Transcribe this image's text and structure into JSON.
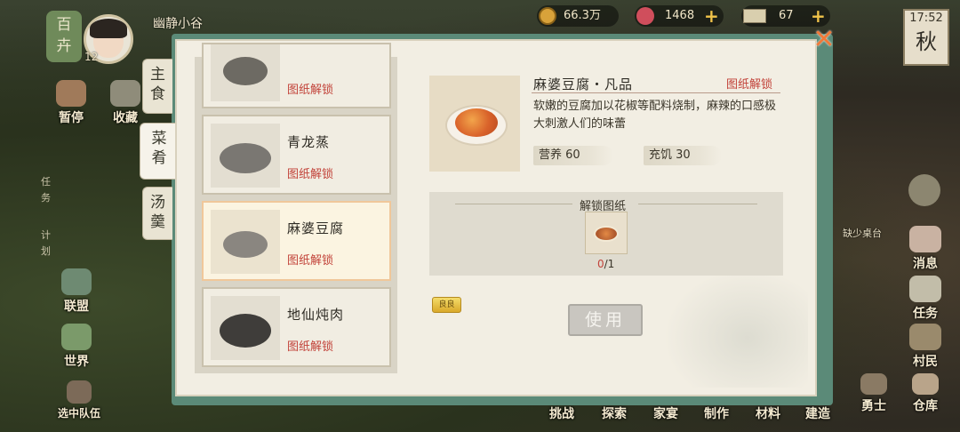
{
  "hud": {
    "region_badge": "百卉",
    "level": "12",
    "player_name": "幽静小谷",
    "copper": "66.3万",
    "gem": "1468",
    "ticket": "67",
    "time": "17:52",
    "season": "秋"
  },
  "left_menu": {
    "item1": "暂停",
    "item2": "收藏",
    "task": "任务",
    "plan": "计划",
    "alliance": "联盟",
    "world": "世界",
    "team": "选中队伍"
  },
  "right_menu": {
    "hint": "缺少桌台",
    "message": "消息",
    "task": "任务",
    "villager": "村民",
    "warrior": "勇士",
    "warehouse": "仓库"
  },
  "bottom_bar": [
    "挑战",
    "探索",
    "家宴",
    "制作",
    "材料",
    "建造"
  ],
  "modal": {
    "tabs": [
      "主食",
      "菜肴",
      "汤羹"
    ],
    "recipes": [
      {
        "name": "",
        "status": "图纸解锁"
      },
      {
        "name": "青龙蒸",
        "status": "图纸解锁"
      },
      {
        "name": "麻婆豆腐",
        "status": "图纸解锁"
      },
      {
        "name": "地仙炖肉",
        "status": "图纸解锁"
      }
    ],
    "detail": {
      "title": "麻婆豆腐・凡品",
      "unlock_status": "图纸解锁",
      "description": "软嫩的豆腐加以花椒等配料烧制，麻辣的口感极大刺激人们的味蕾",
      "stat_nutrition": "营养 60",
      "stat_satiety": "充饥 30"
    },
    "unlock_section": {
      "header": "解锁图纸",
      "have": "0",
      "need": "/1",
      "tag": "良良"
    },
    "use_button": "使用",
    "close": "✕"
  }
}
